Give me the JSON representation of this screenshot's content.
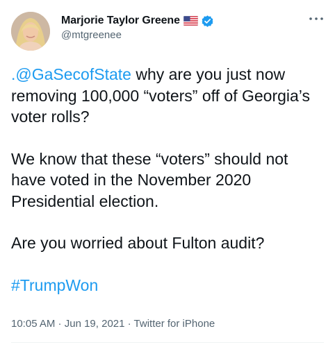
{
  "user": {
    "display_name": "Marjorie Taylor Greene",
    "handle": "@mtgreenee",
    "flag_icon": "us-flag-icon",
    "verified_icon": "verified-badge-icon"
  },
  "tweet": {
    "mention": ".@GaSecofState",
    "line1_rest": " why are you just now removing 100,000 “voters” off of Georgia’s voter rolls?",
    "para2": "We know that these “voters” should not have voted in the November 2020 Presidential election.",
    "para3": "Are you worried about Fulton audit?",
    "hashtag": "#TrumpWon"
  },
  "meta": {
    "time": "10:05 AM",
    "separator1": " · ",
    "date": "Jun 19, 2021",
    "separator2": " · ",
    "source": "Twitter for iPhone"
  },
  "colors": {
    "link": "#1d9bf0",
    "secondary_text": "#536471",
    "primary_text": "#0f1419"
  }
}
